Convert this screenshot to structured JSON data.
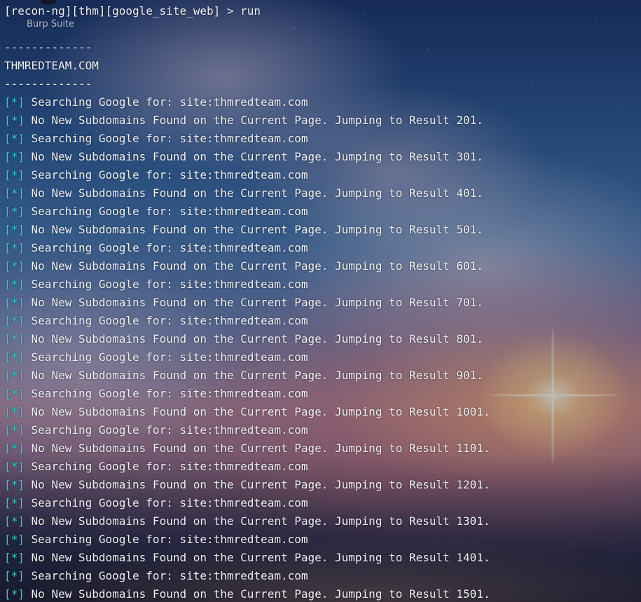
{
  "terminal": {
    "prompt": "[recon-ng][thm][google_site_web] > run",
    "separator": "-------------",
    "domain": "THMREDTEAM.COM",
    "marker": "[*]",
    "output": [
      " Searching Google for: site:thmredteam.com",
      " No New Subdomains Found on the Current Page. Jumping to Result 201.",
      " Searching Google for: site:thmredteam.com",
      " No New Subdomains Found on the Current Page. Jumping to Result 301.",
      " Searching Google for: site:thmredteam.com",
      " No New Subdomains Found on the Current Page. Jumping to Result 401.",
      " Searching Google for: site:thmredteam.com",
      " No New Subdomains Found on the Current Page. Jumping to Result 501.",
      " Searching Google for: site:thmredteam.com",
      " No New Subdomains Found on the Current Page. Jumping to Result 601.",
      " Searching Google for: site:thmredteam.com",
      " No New Subdomains Found on the Current Page. Jumping to Result 701.",
      " Searching Google for: site:thmredteam.com",
      " No New Subdomains Found on the Current Page. Jumping to Result 801.",
      " Searching Google for: site:thmredteam.com",
      " No New Subdomains Found on the Current Page. Jumping to Result 901.",
      " Searching Google for: site:thmredteam.com",
      " No New Subdomains Found on the Current Page. Jumping to Result 1001.",
      " Searching Google for: site:thmredteam.com",
      " No New Subdomains Found on the Current Page. Jumping to Result 1101.",
      " Searching Google for: site:thmredteam.com",
      " No New Subdomains Found on the Current Page. Jumping to Result 1201.",
      " Searching Google for: site:thmredteam.com",
      " No New Subdomains Found on the Current Page. Jumping to Result 1301.",
      " Searching Google for: site:thmredteam.com",
      " No New Subdomains Found on the Current Page. Jumping to Result 1401.",
      " Searching Google for: site:thmredteam.com",
      " No New Subdomains Found on the Current Page. Jumping to Result 1501."
    ]
  },
  "overlay": {
    "app_label": "Burp Suite"
  },
  "colors": {
    "text": "#eef0f4",
    "marker": "#38c8d6"
  }
}
